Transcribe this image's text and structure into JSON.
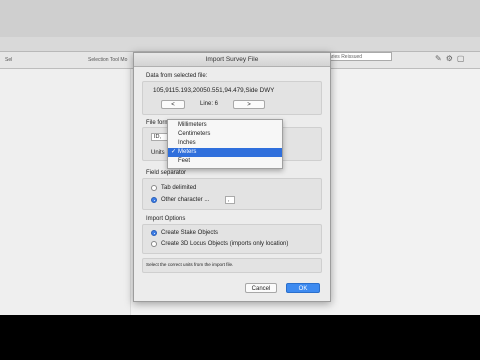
{
  "background": {
    "toolbar_row1": [
      "",
      "",
      ""
    ],
    "toolbar_row2_text": "Selection Tool Mo",
    "toolbar_row2_text2": "Sel",
    "search_placeholder": "Varies Reissued",
    "icons": [
      "tools-icon",
      "gear-icon",
      "folder-icon"
    ]
  },
  "dialog": {
    "title": "Import Survey File",
    "data_section_label": "Data from selected file:",
    "data_line": "105,9115.193,20050.551,94.479,Side DWY",
    "prev_label": "<",
    "line_label": "Line: 6",
    "next_label": ">",
    "file_format_label": "File form",
    "file_format_value": "ID,",
    "units_label": "Units",
    "field_separator_label": "Field separator",
    "tab_delimited_label": "Tab delimited",
    "other_character_label": "Other character ...",
    "other_character_value": ",",
    "import_options_label": "Import Options",
    "create_stake_label": "Create Stake Objects",
    "create_3d_label": "Create 3D Locus Objects (imports only location)",
    "help_text": "Select the correct units from the import file.",
    "cancel_label": "Cancel",
    "ok_label": "OK",
    "field_separator_selected": "other_character",
    "import_option_selected": "create_stake"
  },
  "units_dropdown": {
    "options": [
      "Millimeters",
      "Centimeters",
      "Inches",
      "Meters",
      "Feet"
    ],
    "selected": "Meters",
    "check_glyph": "✓"
  },
  "colors": {
    "accent": "#2f6fdc",
    "ok_button": "#3d8af0"
  }
}
